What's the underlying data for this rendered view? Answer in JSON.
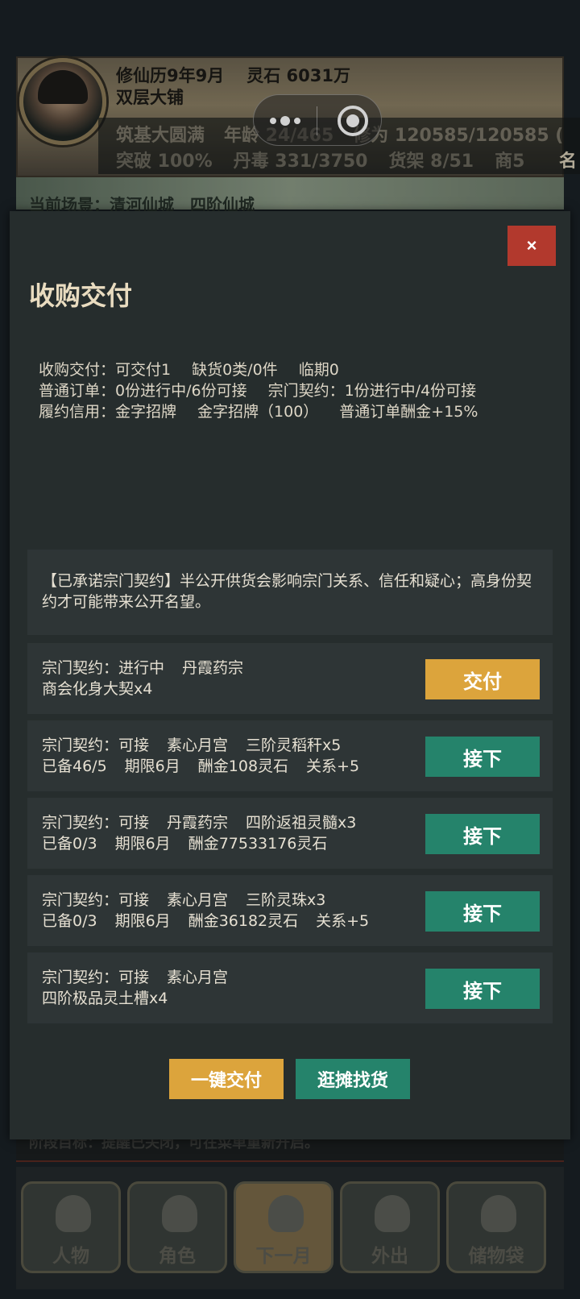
{
  "hud": {
    "calendar": "修仙历9年9月",
    "spirit_stones": "灵石 6031万",
    "shop_name": "双层大铺",
    "realm": "筑基大圆满",
    "age": "年龄 24/465",
    "cultivation": "修为 120585/120585 (",
    "breakthrough": "突破 100%",
    "pill_poison": "丹毒 331/3750",
    "shelves": "货架 8/51",
    "merchant": "商5",
    "fame_cut": "名",
    "scene": "当前场景：清河仙城　四阶仙城",
    "stage_goal": "阶段目标：提醒已关闭，可在菜单重新开启。"
  },
  "nav": [
    {
      "label": "人物"
    },
    {
      "label": "角色"
    },
    {
      "label": "下一月"
    },
    {
      "label": "外出"
    },
    {
      "label": "储物袋"
    }
  ],
  "modal": {
    "title": "收购交付",
    "close_label": "×",
    "summary": {
      "line1": [
        "收购交付：可交付1",
        "缺货0类/0件",
        "临期0"
      ],
      "line2": [
        "普通订单：0份进行中/6份可接",
        "宗门契约：1份进行中/4份可接"
      ],
      "line3": [
        "履约信用：金字招牌",
        "金字招牌（100）",
        "普通订单酬金+15%"
      ]
    },
    "notice": "【已承诺宗门契约】半公开供货会影响宗门关系、信任和疑心；高身份契约才可能带来公开名望。",
    "rows": [
      {
        "line1": [
          "宗门契约：进行中",
          "丹霞药宗"
        ],
        "line2": [
          "商会化身大契x4"
        ],
        "button": "交付"
      },
      {
        "line1": [
          "宗门契约：可接",
          "素心月宫",
          "三阶灵稻秆x5"
        ],
        "line2": [
          "已备46/5",
          "期限6月",
          "酬金108灵石",
          "关系+5"
        ],
        "button": "接下"
      },
      {
        "line1": [
          "宗门契约：可接",
          "丹霞药宗",
          "四阶返祖灵髓x3"
        ],
        "line2": [
          "已备0/3",
          "期限6月",
          "酬金77533176灵石"
        ],
        "button": "接下"
      },
      {
        "line1": [
          "宗门契约：可接",
          "素心月宫",
          "三阶灵珠x3"
        ],
        "line2": [
          "已备0/3",
          "期限6月",
          "酬金36182灵石",
          "关系+5"
        ],
        "button": "接下"
      },
      {
        "line1": [
          "宗门契约：可接",
          "素心月宫"
        ],
        "line2": [
          "四阶极品灵土槽x4"
        ],
        "button": "接下"
      }
    ],
    "deliver_all": "一键交付",
    "browse_stalls": "逛摊找货"
  },
  "colors": {
    "gold_button": "#dca43c",
    "green_button": "#25836b",
    "close_button": "#b2392d",
    "panel_bg": "#262d2d"
  }
}
